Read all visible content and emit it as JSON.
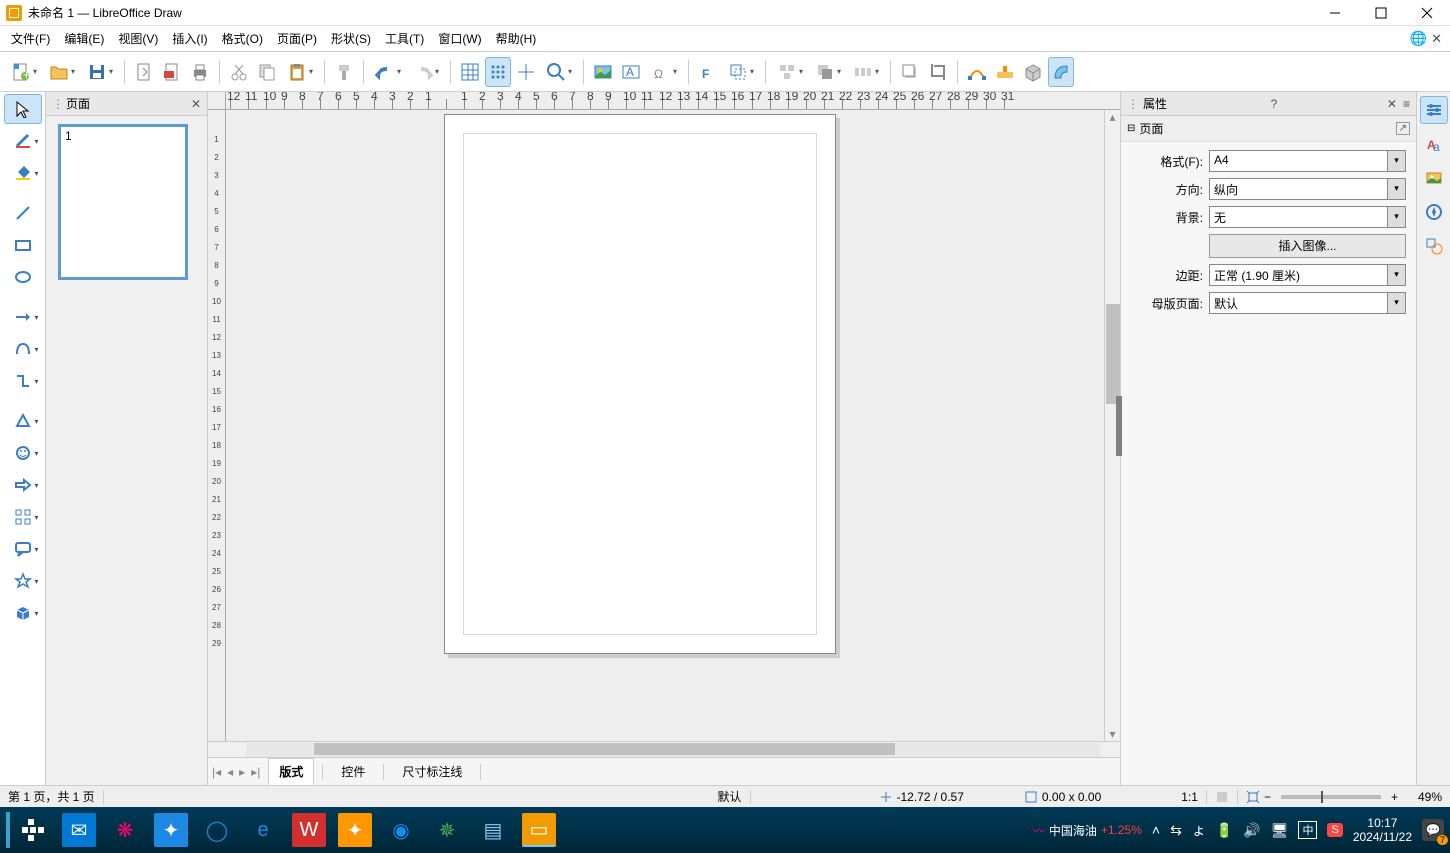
{
  "window": {
    "title": "未命名 1 — LibreOffice Draw"
  },
  "menu": [
    "文件(F)",
    "编辑(E)",
    "视图(V)",
    "插入(I)",
    "格式(O)",
    "页面(P)",
    "形状(S)",
    "工具(T)",
    "窗口(W)",
    "帮助(H)"
  ],
  "pages_panel": {
    "title": "页面",
    "thumb_num": "1"
  },
  "tabs": {
    "nav": [
      "|◂",
      "◂",
      "▸",
      "▸|"
    ],
    "items": [
      "版式",
      "控件",
      "尺寸标注线"
    ],
    "active": 0
  },
  "properties": {
    "title": "属性",
    "section": "页面",
    "format_label": "格式(F):",
    "format_value": "A4",
    "orient_label": "方向:",
    "orient_value": "纵向",
    "bg_label": "背景:",
    "bg_value": "无",
    "insert_image": "插入图像...",
    "margin_label": "边距:",
    "margin_value": "正常 (1.90 厘米)",
    "master_label": "母版页面:",
    "master_value": "默认"
  },
  "status": {
    "page": "第 1 页，共 1 页",
    "style": "默认",
    "coords": "-12.72 / 0.57",
    "size": "0.00 x 0.00",
    "ratio": "1:1",
    "zoom": "49%"
  },
  "taskbar": {
    "stock_name": "中国海油",
    "stock_change": "+1.25%",
    "ime": "中",
    "time": "10:17",
    "date": "2024/11/22",
    "notif_count": "7"
  },
  "ruler_h": [
    "12",
    "11",
    "10",
    "9",
    "8",
    "7",
    "6",
    "5",
    "4",
    "3",
    "2",
    "1",
    "",
    "1",
    "2",
    "3",
    "4",
    "5",
    "6",
    "7",
    "8",
    "9",
    "10",
    "11",
    "12",
    "13",
    "14",
    "15",
    "16",
    "17",
    "18",
    "19",
    "20",
    "21",
    "22",
    "23",
    "24",
    "25",
    "26",
    "27",
    "28",
    "29",
    "30",
    "31"
  ],
  "ruler_v": [
    "",
    "1",
    "2",
    "3",
    "4",
    "5",
    "6",
    "7",
    "8",
    "9",
    "10",
    "11",
    "12",
    "13",
    "14",
    "15",
    "16",
    "17",
    "18",
    "19",
    "20",
    "21",
    "22",
    "23",
    "24",
    "25",
    "26",
    "27",
    "28",
    "29"
  ]
}
